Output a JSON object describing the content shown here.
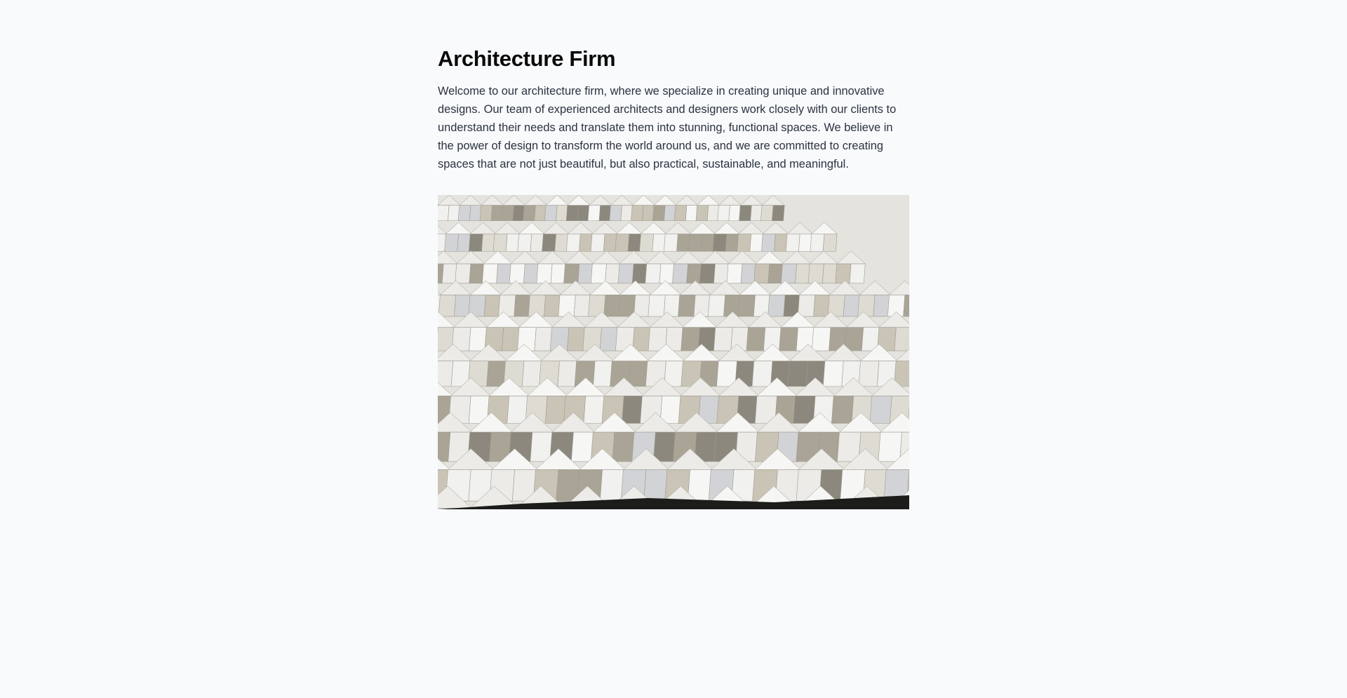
{
  "page": {
    "title": "Architecture Firm",
    "intro": "Welcome to our architecture firm, where we specialize in creating unique and innovative designs. Our team of experienced architects and designers work closely with our clients to understand their needs and translate them into stunning, functional spaces. We believe in the power of design to transform the world around us, and we are committed to creating spaces that are not just beautiful, but also practical, sustainable, and meaningful."
  },
  "colors": {
    "background": "#f8fafc",
    "title": "#0a0a0a",
    "body_text": "#2b3340"
  }
}
